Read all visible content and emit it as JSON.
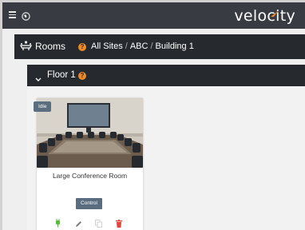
{
  "app": {
    "logo_text": "velocity",
    "brand_accent": "#f08a24",
    "topbar_color": "#383c42",
    "bar_color": "#262a2e"
  },
  "breadcrumb": {
    "section_label": "Rooms",
    "items": [
      "All Sites",
      "ABC",
      "Building 1"
    ],
    "separator": "/"
  },
  "floor": {
    "title": "Floor 1",
    "help_glyph": "?"
  },
  "room_card": {
    "status": "Idle",
    "name": "Large Conference Room",
    "control_label": "Control",
    "actions": [
      "plug-icon",
      "edit-pencil-icon",
      "copy-icon",
      "delete-trash-icon"
    ]
  }
}
